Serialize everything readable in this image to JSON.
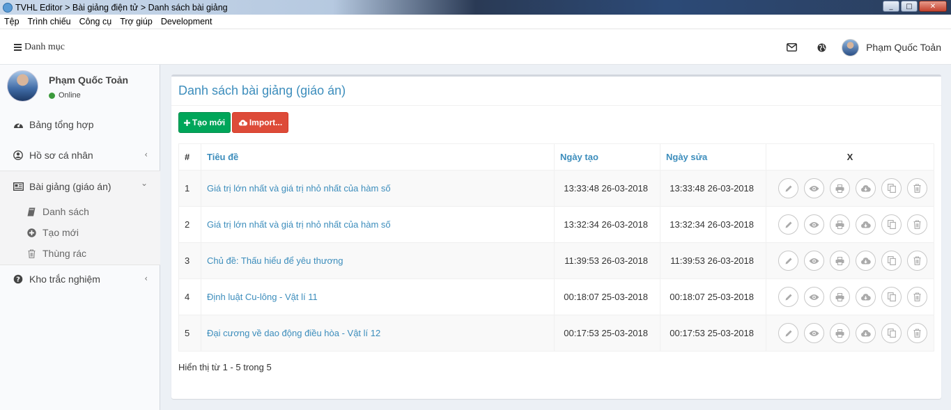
{
  "window": {
    "title": "TVHL Editor > Bài giảng điện tử > Danh sách bài giảng",
    "minimize": "_",
    "maximize": "□",
    "close": "✕"
  },
  "menubar": [
    "Tệp",
    "Trình chiếu",
    "Công cụ",
    "Trợ giúp",
    "Development"
  ],
  "topnav": {
    "menu_label": "Danh mục",
    "user_name": "Phạm Quốc Toản",
    "icons": [
      "envelope-icon",
      "globe-icon"
    ]
  },
  "sidebar": {
    "user_name": "Phạm Quốc Toản",
    "status": "Online",
    "items": [
      {
        "label": "Bảng tổng hợp",
        "icon": "dashboard-icon"
      },
      {
        "label": "Hồ sơ cá nhân",
        "icon": "user-circle-icon",
        "chevron": "‹"
      },
      {
        "label": "Bài giảng (giáo án)",
        "icon": "newspaper-icon",
        "chevron": "⌄"
      },
      {
        "label": "Kho trắc nghiệm",
        "icon": "question-circle-icon",
        "chevron": "‹"
      }
    ],
    "submenu": [
      {
        "label": "Danh sách",
        "icon": "book-icon"
      },
      {
        "label": "Tạo mới",
        "icon": "plus-circle-icon"
      },
      {
        "label": "Thùng rác",
        "icon": "trash-icon"
      }
    ]
  },
  "content": {
    "title": "Danh sách bài giảng (giáo án)",
    "btn_new": "Tạo mới",
    "btn_import": "Import...",
    "columns": [
      "#",
      "Tiêu đề",
      "Ngày tạo",
      "Ngày sửa",
      "X"
    ],
    "rows": [
      {
        "n": "1",
        "title": "Giá trị lớn nhất và giá trị nhỏ nhất của hàm số",
        "created": "13:33:48 26-03-2018",
        "modified": "13:33:48 26-03-2018"
      },
      {
        "n": "2",
        "title": "Giá trị lớn nhất và giá trị nhỏ nhất của hàm số",
        "created": "13:32:34 26-03-2018",
        "modified": "13:32:34 26-03-2018"
      },
      {
        "n": "3",
        "title": "Chủ đề: Thấu hiểu để yêu thương",
        "created": "11:39:53 26-03-2018",
        "modified": "11:39:53 26-03-2018"
      },
      {
        "n": "4",
        "title": "Định luật Cu-lông - Vật lí 11",
        "created": "00:18:07 25-03-2018",
        "modified": "00:18:07 25-03-2018"
      },
      {
        "n": "5",
        "title": "Đại cương về dao động điều hòa - Vật lí 12",
        "created": "00:17:53 25-03-2018",
        "modified": "00:17:53 25-03-2018"
      }
    ],
    "row_actions": [
      "pencil-icon",
      "eye-icon",
      "print-icon",
      "cloud-download-icon",
      "copy-icon",
      "trash-icon"
    ],
    "footer": "Hiển thị từ 1 - 5 trong 5"
  },
  "colors": {
    "link": "#3c8dbc",
    "success": "#00a65a",
    "danger": "#dd4b39",
    "online": "#3c9a3c"
  }
}
